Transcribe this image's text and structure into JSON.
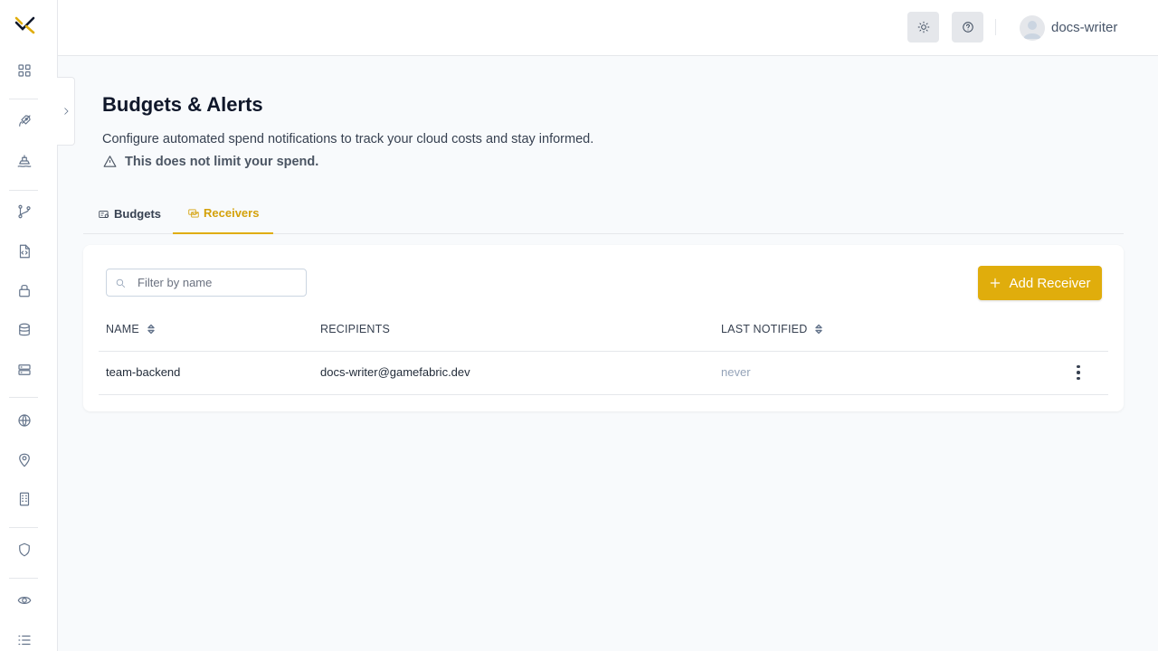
{
  "topbar": {
    "username": "docs-writer",
    "theme_icon": "sun-icon",
    "help_icon": "help-circle-icon"
  },
  "sidebar": {
    "items": [
      {
        "icon": "grid-icon"
      },
      {
        "icon": "rocket-icon"
      },
      {
        "icon": "ship-icon"
      },
      {
        "icon": "git-branch-icon"
      },
      {
        "icon": "file-code-icon"
      },
      {
        "icon": "lock-icon"
      },
      {
        "icon": "database-icon"
      },
      {
        "icon": "server-icon"
      },
      {
        "icon": "globe-icon"
      },
      {
        "icon": "map-pin-icon"
      },
      {
        "icon": "building-icon"
      },
      {
        "icon": "shield-icon"
      },
      {
        "icon": "eye-icon"
      },
      {
        "icon": "list-icon"
      }
    ]
  },
  "page": {
    "title": "Budgets & Alerts",
    "description": "Configure automated spend notifications to track your cloud costs and stay informed.",
    "warning": "This does not limit your spend."
  },
  "tabs": [
    {
      "label": "Budgets",
      "active": false
    },
    {
      "label": "Receivers",
      "active": true
    }
  ],
  "toolbar": {
    "search_placeholder": "Filter by name",
    "search_value": "",
    "add_label": "Add Receiver"
  },
  "table": {
    "columns": [
      "NAME",
      "RECIPIENTS",
      "LAST NOTIFIED"
    ],
    "rows": [
      {
        "name": "team-backend",
        "recipients": "docs-writer@gamefabric.dev",
        "last_notified": "never"
      }
    ]
  },
  "colors": {
    "accent": "#e0ad0c",
    "accent_text": "#d4a10a"
  }
}
